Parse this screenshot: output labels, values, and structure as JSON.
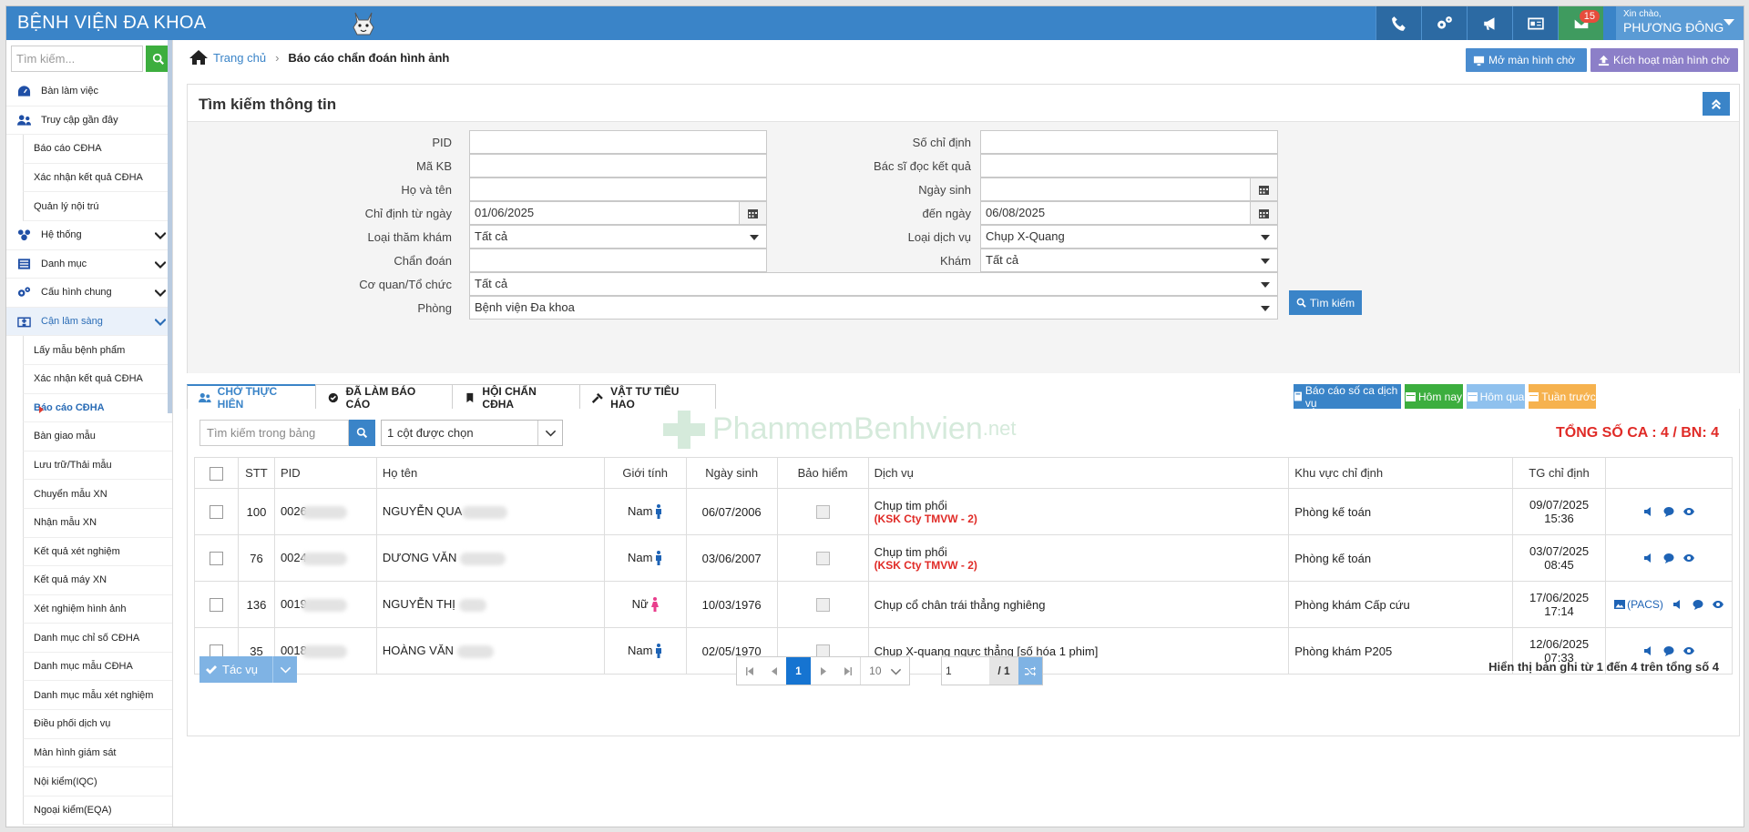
{
  "app": {
    "title": "BỆNH VIỆN ĐA KHOA"
  },
  "user": {
    "greeting": "Xin chào,",
    "name": "PHƯƠNG ĐÔNG"
  },
  "notifications": {
    "mail_count": "15"
  },
  "sidebar": {
    "search_placeholder": "Tìm kiếm...",
    "items": [
      {
        "label": "Bàn làm việc",
        "icon": "dashboard-icon"
      },
      {
        "label": "Truy cập gần đây",
        "icon": "users-icon"
      },
      {
        "label": "Báo cáo CĐHA"
      },
      {
        "label": "Xác nhận kết quả CĐHA"
      },
      {
        "label": "Quản lý nội trú"
      },
      {
        "label": "Hệ thống",
        "icon": "sitemap-icon"
      },
      {
        "label": "Danh mục",
        "icon": "list-icon"
      },
      {
        "label": "Cấu hình chung",
        "icon": "cogs-icon"
      },
      {
        "label": "Cận lâm sàng",
        "icon": "hospital-icon"
      },
      {
        "label": "Lấy mẫu bệnh phẩm"
      },
      {
        "label": "Xác nhận kết quả CĐHA"
      },
      {
        "label": "Báo cáo CĐHA"
      },
      {
        "label": "Bàn giao mẫu"
      },
      {
        "label": "Lưu trữ/Thải mẫu"
      },
      {
        "label": "Chuyển mẫu XN"
      },
      {
        "label": "Nhận mẫu XN"
      },
      {
        "label": "Kết quả xét nghiệm"
      },
      {
        "label": "Kết quả máy XN"
      },
      {
        "label": "Xét nghiệm hình ảnh"
      },
      {
        "label": "Danh mục chỉ số CĐHA"
      },
      {
        "label": "Danh mục mẫu CĐHA"
      },
      {
        "label": "Danh mục mẫu xét nghiệm"
      },
      {
        "label": "Điều phối dịch vụ"
      },
      {
        "label": "Màn hình giám sát"
      },
      {
        "label": "Nội kiểm(IQC)"
      },
      {
        "label": "Ngoại kiểm(EQA)"
      }
    ]
  },
  "breadcrumb": {
    "home": "Trang chủ",
    "current": "Báo cáo chẩn đoán hình ảnh"
  },
  "header_buttons": {
    "open_wait": "Mở màn hình chờ",
    "activate_wait": "Kích hoạt màn hình chờ"
  },
  "search": {
    "title": "Tìm kiếm thông tin",
    "labels": {
      "pid": "PID",
      "ma_kb": "Mã KB",
      "ho_ten": "Họ và tên",
      "chi_dinh_tu": "Chỉ định từ ngày",
      "loai_tham_kham": "Loại thăm khám",
      "chan_doan": "Chẩn đoán",
      "co_quan": "Cơ quan/Tổ chức",
      "phong": "Phòng",
      "so_chi_dinh": "Số chỉ định",
      "bac_si": "Bác sĩ đọc kết quả",
      "ngay_sinh": "Ngày sinh",
      "den_ngay": "đến ngày",
      "loai_dich_vu": "Loại dịch vụ",
      "kham": "Khám"
    },
    "values": {
      "pid": "",
      "ma_kb": "",
      "ho_ten": "",
      "chi_dinh_tu": "01/06/2025",
      "loai_tham_kham": "Tất cả",
      "chan_doan": "",
      "co_quan": "Tất cả",
      "phong": "Bệnh viện Đa khoa",
      "so_chi_dinh": "",
      "bac_si": "",
      "ngay_sinh": "",
      "den_ngay": "06/08/2025",
      "loai_dich_vu": "Chụp X-Quang",
      "kham": "Tất cả"
    },
    "button": "Tìm kiếm"
  },
  "tabs": [
    {
      "label": "CHỜ THỰC HIỆN",
      "icon": "users-icon"
    },
    {
      "label": "ĐÃ LÀM BÁO CÁO",
      "icon": "check-circle-icon"
    },
    {
      "label": "HỘI CHẨN CĐHA",
      "icon": "bookmark-icon"
    },
    {
      "label": "VẬT TƯ TIÊU HAO",
      "icon": "tools-icon"
    }
  ],
  "right_buttons": {
    "report": "Báo cáo số ca dịch vụ",
    "today": "Hôm nay",
    "yesterday": "Hôm qua",
    "last_week": "Tuần trước",
    "colors": {
      "report": "#3a84c8",
      "today": "#3cae3e",
      "yesterday": "#8fc1ee",
      "last_week": "#f6b24e"
    }
  },
  "table": {
    "search_placeholder": "Tìm kiếm trong bảng",
    "columns_selected": "1 cột được chọn",
    "total": "TỔNG SỐ CA : 4 / BN: 4",
    "watermark": {
      "main": "PhanmemBenhvien",
      "suffix": ".net"
    },
    "headers": [
      "STT",
      "PID",
      "Họ tên",
      "Giới tính",
      "Ngày sinh",
      "Bảo hiểm",
      "Dịch vụ",
      "Khu vực chỉ định",
      "TG chỉ định"
    ],
    "rows": [
      {
        "stt": "100",
        "pid": "0026",
        "name": "NGUYỄN QUA",
        "gender": "Nam",
        "dob": "06/07/2006",
        "service": "Chụp tim phổi",
        "tag": "(KSK Cty TMVW - 2)",
        "area": "Phòng kế toán",
        "date": "09/07/2025",
        "time": "15:36",
        "pacs": ""
      },
      {
        "stt": "76",
        "pid": "0024",
        "name": "DƯƠNG VĂN",
        "gender": "Nam",
        "dob": "03/06/2007",
        "service": "Chụp tim phổi",
        "tag": "(KSK Cty TMVW - 2)",
        "area": "Phòng kế toán",
        "date": "03/07/2025",
        "time": "08:45",
        "pacs": ""
      },
      {
        "stt": "136",
        "pid": "0019",
        "name": "NGUYỄN THỊ",
        "gender": "Nữ",
        "dob": "10/03/1976",
        "service": "Chụp cổ chân trái thẳng nghiêng",
        "tag": "",
        "area": "Phòng khám Cấp cứu",
        "date": "17/06/2025",
        "time": "17:14",
        "pacs": "(PACS)"
      },
      {
        "stt": "35",
        "pid": "0018",
        "name": "HOÀNG VĂN",
        "gender": "Nam",
        "dob": "02/05/1970",
        "service": "Chụp X-quang ngực thẳng [số hóa 1 phim]",
        "tag": "",
        "area": "Phòng khám P205",
        "date": "12/06/2025",
        "time": "07:33",
        "pacs": ""
      }
    ]
  },
  "pager": {
    "actions": "Tác vụ",
    "current_page": "1",
    "page_size": "10",
    "goto_value": "1",
    "total_pages": "/ 1",
    "records": "Hiển thị bản ghi từ 1 đến 4 trên tổng số 4"
  }
}
